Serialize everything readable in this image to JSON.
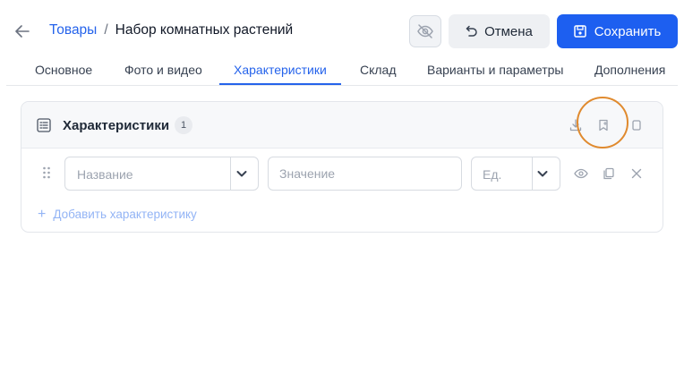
{
  "header": {
    "breadcrumb_parent": "Товары",
    "breadcrumb_separator": "/",
    "breadcrumb_current": "Набор комнатных растений",
    "cancel_label": "Отмена",
    "save_label": "Сохранить"
  },
  "tabs": [
    {
      "label": "Основное",
      "active": false
    },
    {
      "label": "Фото и видео",
      "active": false
    },
    {
      "label": "Характеристики",
      "active": true
    },
    {
      "label": "Склад",
      "active": false
    },
    {
      "label": "Варианты и параметры",
      "active": false
    },
    {
      "label": "Дополнения",
      "active": false
    }
  ],
  "card": {
    "title": "Характеристики",
    "count": "1",
    "row": {
      "name_placeholder": "Название",
      "value_placeholder": "Значение",
      "unit_placeholder": "Ед."
    },
    "add_label": "Добавить характеристику"
  },
  "icons": {
    "back": "arrow-left-icon",
    "visibility": "eye-off-icon",
    "cancel": "undo-icon",
    "save": "floppy-disk-icon",
    "card": "list-icon",
    "download": "download-icon",
    "bookmark": "bookmark-icon",
    "copy": "square-icon",
    "drag": "drag-handle-icon",
    "dropdown": "chevron-down-icon",
    "row_visibility": "eye-icon",
    "row_duplicate": "duplicate-icon",
    "row_remove": "close-icon"
  },
  "colors": {
    "primary": "#1d5ff0",
    "link": "#2563eb",
    "highlight_ring": "#e08a2e"
  }
}
